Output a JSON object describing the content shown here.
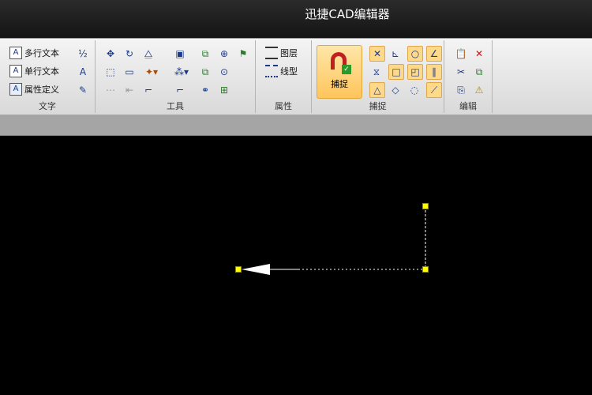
{
  "app": {
    "title": "迅捷CAD编辑器"
  },
  "ribbon": {
    "text_group": {
      "label": "文字",
      "buttons": [
        "多行文本",
        "单行文本",
        "属性定义"
      ]
    },
    "tools_group": {
      "label": "工具"
    },
    "props_group": {
      "label": "属性",
      "buttons": [
        "图层",
        "线型"
      ]
    },
    "snap_group": {
      "label": "捕捉",
      "main_button": "捕捉"
    },
    "edit_group": {
      "label": "编辑"
    }
  },
  "colors": {
    "canvas": "#000000",
    "grip": "#ffff00",
    "accent": "#ffc55c"
  }
}
